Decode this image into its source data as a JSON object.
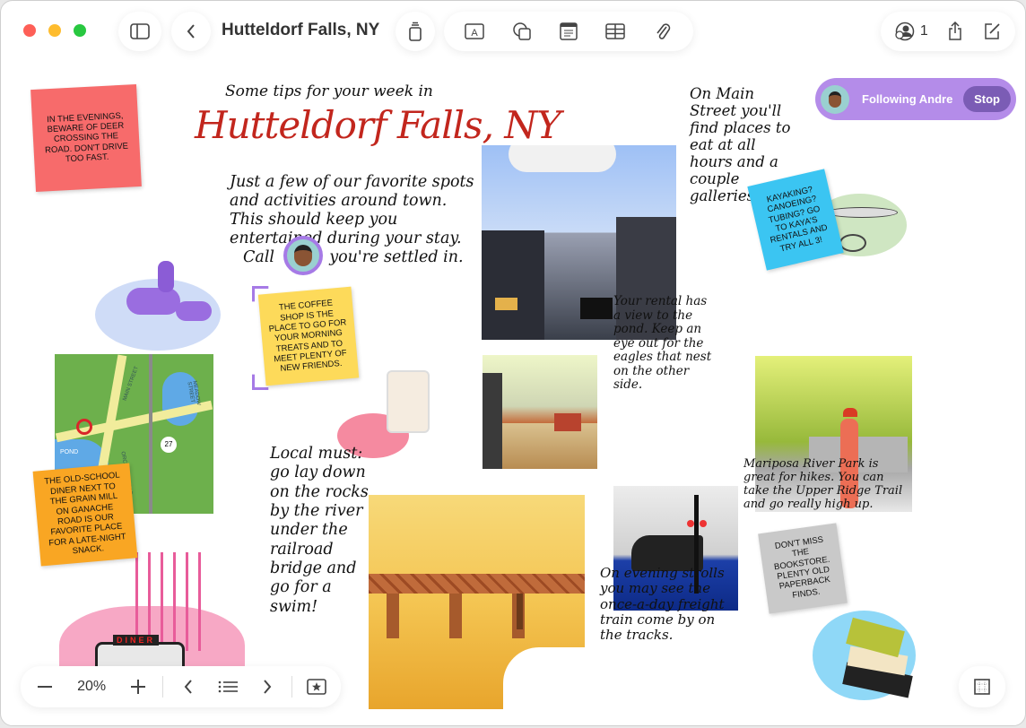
{
  "window": {
    "title": "Hutteldorf Falls, NY"
  },
  "toolbar": {
    "collaborators_count": "1",
    "icons": [
      "sidebar-icon",
      "back-chevron-icon",
      "stack-icon",
      "text-box-icon",
      "shapes-icon",
      "sticky-note-icon",
      "table-icon",
      "paperclip-icon",
      "collaboration-icon",
      "share-icon",
      "compose-icon"
    ]
  },
  "following": {
    "label": "Following Andre",
    "stop": "Stop"
  },
  "stickies": {
    "red": "In the evenings, beware of deer crossing the road. Don't drive too fast.",
    "blue": "Kayaking? Canoeing? Tubing? Go to Kaya's Rentals and try all 3!",
    "yellow": "The coffee shop is the place to go for your morning treats and to meet plenty of new friends.",
    "orange": "The old-school diner next to the grain mill on Ganache Road is our favorite place for a late-night snack.",
    "gray": "Don't miss the bookstore. Plenty old paperback finds."
  },
  "notes": {
    "intro": "Some tips for your week in",
    "headline": "Hutteldorf Falls, NY",
    "paragraph_a": "Just a few of our favorite spots and activities around town. This should keep you entertained during your stay.",
    "paragraph_call": "Call",
    "paragraph_b": "you're settled in.",
    "main_street": "On Main Street you'll find places to eat at all hours and a couple galleries.",
    "rental": "Your rental has a view to the pond. Keep an eye out for the eagles that nest on the other side.",
    "local_must": "Local must: go lay down on the rocks by the river under the railroad bridge and go for a swim!",
    "mariposa": "Mariposa River Park is great for hikes. You can take the Upper Ridge Trail and go really high up.",
    "evening": "On evening strolls you may see the once-a-day freight train come by on the tracks."
  },
  "map": {
    "pond": "POND",
    "road_number": "27",
    "streets": [
      "MAIN STREET",
      "ORCHARD ROAD",
      "MEADOW STREET"
    ]
  },
  "diner_sign": "DINER",
  "zoom": {
    "level": "20%"
  },
  "colors": {
    "accent_purple": "#b48ce9",
    "stop_button": "#7b5cb5",
    "headline_red": "#c2261d"
  }
}
